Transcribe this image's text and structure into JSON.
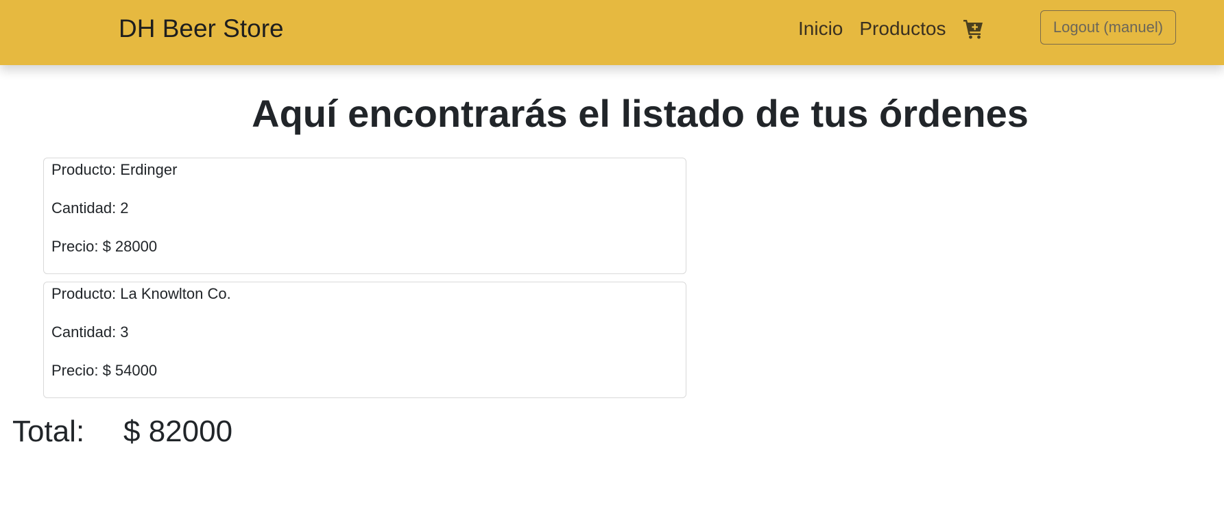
{
  "navbar": {
    "brand": "DH Beer Store",
    "links": [
      {
        "label": "Inicio"
      },
      {
        "label": "Productos"
      }
    ],
    "cart_icon": "cart-plus-icon",
    "logout_label": "Logout (manuel)",
    "background_color": "#e6b940"
  },
  "main": {
    "title": "Aquí encontrarás el listado de tus órdenes",
    "orders": [
      {
        "product": "Producto: Erdinger",
        "quantity": "Cantidad: 2",
        "price": "Precio: $ 28000"
      },
      {
        "product": "Producto: La Knowlton Co.",
        "quantity": "Cantidad: 3",
        "price": "Precio: $ 54000"
      }
    ],
    "total_label": "Total:",
    "total_value": "$ 82000"
  }
}
